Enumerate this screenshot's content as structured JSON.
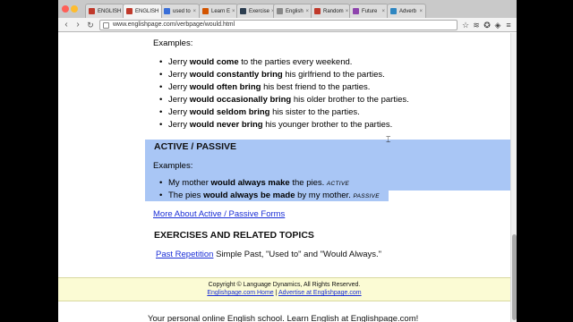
{
  "browser": {
    "tabs": [
      {
        "label": "ENGLISH",
        "fav_color": "#c0392b",
        "active": false
      },
      {
        "label": "ENGLISH",
        "fav_color": "#c0392b",
        "active": true
      },
      {
        "label": "used to",
        "fav_color": "#3a6fd8",
        "active": false
      },
      {
        "label": "Learn E",
        "fav_color": "#d35400",
        "active": false
      },
      {
        "label": "Exercise",
        "fav_color": "#2c3e50",
        "active": false
      },
      {
        "label": "English",
        "fav_color": "#888888",
        "active": false
      },
      {
        "label": "Random",
        "fav_color": "#c0392b",
        "active": false
      },
      {
        "label": "Future",
        "fav_color": "#8e44ad",
        "active": false
      },
      {
        "label": "Adverb",
        "fav_color": "#2e86c1",
        "active": false
      }
    ],
    "url": "www.englishpage.com/verbpage/would.html"
  },
  "page": {
    "examples_label_1": "Examples:",
    "list1": [
      {
        "pre": "Jerry ",
        "bold": "would come",
        "post": " to the parties every weekend."
      },
      {
        "pre": "Jerry ",
        "bold": "would constantly bring",
        "post": " his girlfriend to the parties."
      },
      {
        "pre": "Jerry ",
        "bold": "would often bring",
        "post": " his best friend to the parties."
      },
      {
        "pre": "Jerry ",
        "bold": "would occasionally bring",
        "post": " his older brother to the parties."
      },
      {
        "pre": "Jerry ",
        "bold": "would seldom bring",
        "post": " his sister to the parties."
      },
      {
        "pre": "Jerry ",
        "bold": "would never bring",
        "post": " his younger brother to the parties."
      }
    ],
    "active_passive_heading": "ACTIVE / PASSIVE",
    "examples_label_2": "Examples:",
    "list2": [
      {
        "pre": "My mother ",
        "bold": "would always make",
        "post": " the pies. ",
        "tag": "ACTIVE"
      },
      {
        "pre": "The pies ",
        "bold": "would always be made",
        "post": " by my mother. ",
        "tag": "PASSIVE"
      }
    ],
    "more_link": "More About Active / Passive Forms",
    "exercises_heading": "EXERCISES AND RELATED TOPICS",
    "exercise_link": "Past Repetition",
    "exercise_text": " Simple Past, \"Used to\" and \"Would Always.\"",
    "footer": {
      "copyright": "Copyright © Language Dynamics, All Rights Reserved.",
      "home_link": "Englishpage.com Home",
      "separator": " | ",
      "advertise_link": "Advertise at Englishpage.com"
    },
    "bottom_text": "Your personal online English school. Learn English at Englishpage.com!"
  }
}
